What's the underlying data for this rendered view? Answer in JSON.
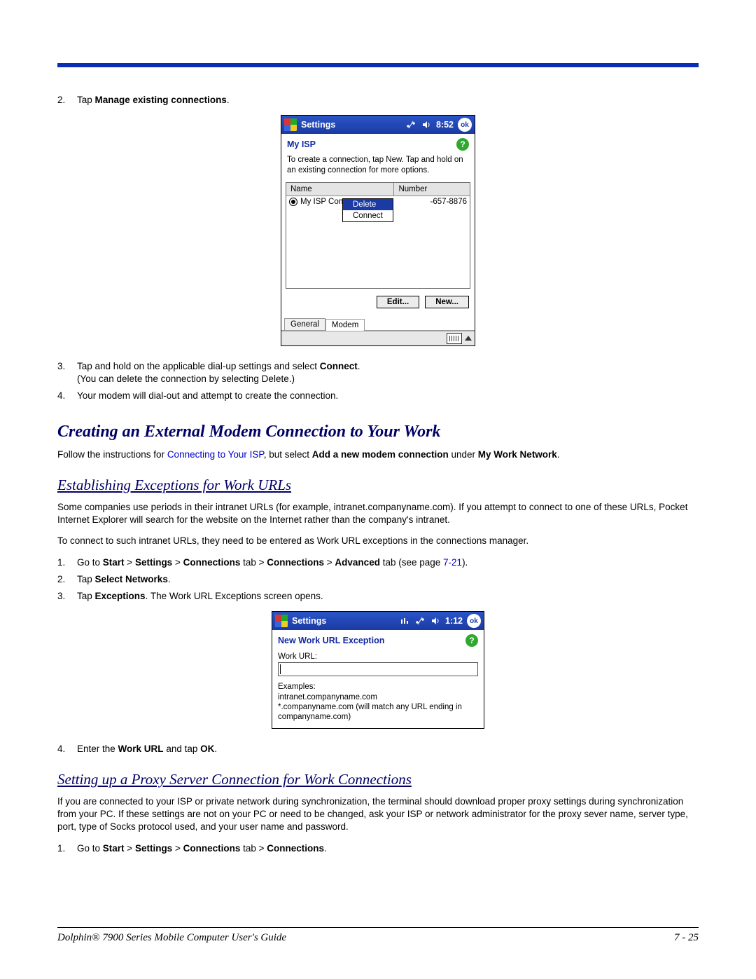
{
  "top": {
    "step2_num": "2.",
    "step2_pre": "Tap ",
    "step2_bold": "Manage existing connections",
    "step2_post": "."
  },
  "shot1": {
    "title": "Settings",
    "time": "8:52",
    "ok": "ok",
    "apptitle": "My ISP",
    "help": "?",
    "instr": "To create a connection, tap New. Tap and hold on an existing connection for more options.",
    "col_name": "Name",
    "col_number": "Number",
    "row_name": "My ISP Con",
    "row_number": "-657-8876",
    "menu_delete": "Delete",
    "menu_connect": "Connect",
    "btn_edit": "Edit...",
    "btn_new": "New...",
    "tab_general": "General",
    "tab_modem": "Modem"
  },
  "mid": {
    "step3_num": "3.",
    "step3_a": "Tap and hold on the applicable dial-up settings and select ",
    "step3_bold": "Connect",
    "step3_b": ".",
    "step3_sub": "(You can delete the connection by selecting Delete.)",
    "step4_num": "4.",
    "step4": "Your modem will dial-out and attempt to create the connection."
  },
  "sec1": {
    "title": "Creating an External Modem Connection to Your Work",
    "p_pre": "Follow the instructions for ",
    "p_link": "Connecting to Your ISP",
    "p_mid": ", but select ",
    "p_b1": "Add a new modem connection",
    "p_mid2": " under ",
    "p_b2": "My Work Network",
    "p_end": "."
  },
  "sec2": {
    "title": "Establishing Exceptions for Work URLs",
    "p1": "Some companies use periods in their intranet URLs (for example, intranet.companyname.com). If you attempt to connect to one of these URLs, Pocket Internet Explorer will search for the website on the Internet rather than the company's intranet.",
    "p2": "To connect to such intranet URLs, they need to be entered as Work URL exceptions in the connections manager.",
    "s1_num": "1.",
    "s1_pre": "Go to ",
    "s1_b1": "Start",
    "s1_gt1": " > ",
    "s1_b2": "Settings",
    "s1_gt2": " > ",
    "s1_b3": "Connections",
    "s1_mid1": " tab > ",
    "s1_b4": "Connections",
    "s1_gt3": " > ",
    "s1_b5": "Advanced",
    "s1_mid2": " tab (see page ",
    "s1_link": "7-21",
    "s1_end": ").",
    "s2_num": "2.",
    "s2_pre": "Tap ",
    "s2_bold": "Select Networks",
    "s2_end": ".",
    "s3_num": "3.",
    "s3_pre": "Tap ",
    "s3_bold": "Exceptions",
    "s3_end": ". The Work URL Exceptions screen opens."
  },
  "shot2": {
    "title": "Settings",
    "time": "1:12",
    "ok": "ok",
    "apptitle": "New Work URL Exception",
    "help": "?",
    "label": "Work URL:",
    "examples_hdr": "Examples:",
    "ex1": "intranet.companyname.com",
    "ex2": "*.companyname.com (will match any URL ending in companyname.com)"
  },
  "sec2b": {
    "s4_num": "4.",
    "s4_pre": "Enter the ",
    "s4_bold": "Work URL",
    "s4_mid": " and tap ",
    "s4_bold2": "OK",
    "s4_end": "."
  },
  "sec3": {
    "title": "Setting up a Proxy Server Connection for Work Connections",
    "p1": "If you are connected to your ISP or private network during synchronization, the terminal should download proper proxy settings during synchronization from your PC. If these settings are not on your PC or need to be changed, ask your ISP or network administrator for the proxy sever name, server type, port, type of Socks protocol used, and your user name and password.",
    "s1_num": "1.",
    "s1_pre": "Go to ",
    "s1_b1": "Start",
    "s1_gt1": " > ",
    "s1_b2": "Settings",
    "s1_gt2": " > ",
    "s1_b3": "Connections",
    "s1_mid1": " tab > ",
    "s1_b4": "Connections",
    "s1_end": "."
  },
  "footer": {
    "left": "Dolphin® 7900 Series Mobile Computer User's Guide",
    "right": "7 - 25"
  }
}
